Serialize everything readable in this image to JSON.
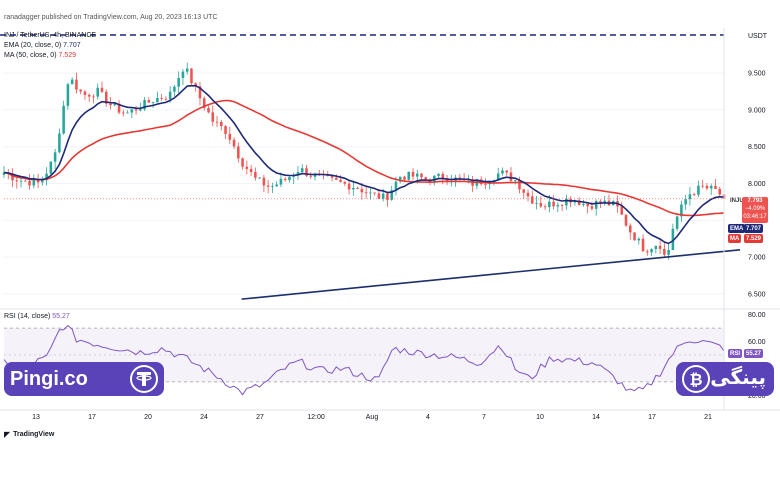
{
  "header": {
    "published": "ranadagger published on TradingView.com, Aug 20, 2023 16:13 UTC",
    "symbol_line": "INJ / TetherUS, 4h, BINANCE",
    "ema_legend": "EMA (20, close, 0)",
    "ema_value": "7.707",
    "ma_legend": "MA (50, close, 0)",
    "ma_value": "7.529",
    "rsi_legend": "RSI (14, close)",
    "rsi_value": "55.27",
    "currency": "USDT"
  },
  "badges": {
    "symbol": "INJUSDT",
    "price": "7.793",
    "change": "−4.09%",
    "countdown": "03:46:17",
    "ema_tag": "EMA",
    "ema_val": "7.707",
    "ma_tag": "MA",
    "ma_val": "7.529",
    "rsi_tag": "RSI",
    "rsi_val": "55.27"
  },
  "footer": {
    "tradingview": "TradingView",
    "logo_left": "Pingi.co",
    "logo_right": "پینگی"
  },
  "colors": {
    "up": "#26a69a",
    "down": "#ef5350",
    "ema": "#1e2a78",
    "ma": "#e53935",
    "rsi": "#7e57c2",
    "trendline": "#1a2f6b",
    "brand": "#5a43b8"
  },
  "chart_data": {
    "type": "candlestick",
    "price_axis_ticks": [
      "9.500",
      "9.000",
      "8.500",
      "8.000",
      "7.500",
      "7.000",
      "6.500"
    ],
    "rsi_axis_ticks": [
      "80.00",
      "60.00",
      "40.00",
      "20.00"
    ],
    "rsi_bands": [
      30,
      70
    ],
    "x_ticks": [
      "13",
      "17",
      "20",
      "24",
      "27",
      "12:00",
      "Aug",
      "4",
      "7",
      "10",
      "14",
      "17",
      "21"
    ],
    "price_ylim": [
      6.35,
      9.95
    ],
    "rsi_ylim": [
      15,
      82
    ],
    "last_price": 7.793,
    "ema_last": 7.707,
    "ma_last": 7.529,
    "rsi_last": 55.27,
    "trendline_endpoints": [
      {
        "t": 0.33,
        "price": 6.43
      },
      {
        "t": 1.0,
        "price": 7.1
      }
    ],
    "close_keypoints": [
      [
        0.0,
        8.15
      ],
      [
        0.02,
        8.05
      ],
      [
        0.05,
        8.0
      ],
      [
        0.07,
        8.35
      ],
      [
        0.09,
        9.45
      ],
      [
        0.11,
        9.2
      ],
      [
        0.13,
        9.25
      ],
      [
        0.15,
        9.05
      ],
      [
        0.17,
        8.95
      ],
      [
        0.19,
        9.05
      ],
      [
        0.21,
        9.15
      ],
      [
        0.23,
        9.2
      ],
      [
        0.25,
        9.6
      ],
      [
        0.27,
        9.2
      ],
      [
        0.29,
        8.85
      ],
      [
        0.31,
        8.7
      ],
      [
        0.33,
        8.3
      ],
      [
        0.35,
        8.05
      ],
      [
        0.37,
        7.95
      ],
      [
        0.39,
        8.05
      ],
      [
        0.41,
        8.2
      ],
      [
        0.43,
        8.1
      ],
      [
        0.45,
        8.05
      ],
      [
        0.47,
        8.0
      ],
      [
        0.49,
        7.95
      ],
      [
        0.51,
        7.85
      ],
      [
        0.53,
        7.8
      ],
      [
        0.55,
        8.1
      ],
      [
        0.57,
        8.1
      ],
      [
        0.59,
        8.05
      ],
      [
        0.61,
        8.1
      ],
      [
        0.63,
        8.05
      ],
      [
        0.65,
        8.0
      ],
      [
        0.67,
        8.05
      ],
      [
        0.69,
        8.15
      ],
      [
        0.71,
        8.05
      ],
      [
        0.73,
        7.8
      ],
      [
        0.75,
        7.7
      ],
      [
        0.77,
        7.75
      ],
      [
        0.79,
        7.8
      ],
      [
        0.81,
        7.7
      ],
      [
        0.83,
        7.75
      ],
      [
        0.85,
        7.7
      ],
      [
        0.87,
        7.35
      ],
      [
        0.89,
        7.1
      ],
      [
        0.91,
        7.2
      ],
      [
        0.92,
        6.95
      ],
      [
        0.93,
        7.45
      ],
      [
        0.95,
        7.85
      ],
      [
        0.97,
        7.95
      ],
      [
        0.99,
        7.9
      ],
      [
        1.0,
        7.793
      ]
    ],
    "rsi_keypoints": [
      [
        0.0,
        45
      ],
      [
        0.03,
        42
      ],
      [
        0.06,
        48
      ],
      [
        0.08,
        72
      ],
      [
        0.09,
        70
      ],
      [
        0.1,
        62
      ],
      [
        0.13,
        58
      ],
      [
        0.16,
        55
      ],
      [
        0.19,
        52
      ],
      [
        0.22,
        55
      ],
      [
        0.25,
        48
      ],
      [
        0.27,
        42
      ],
      [
        0.3,
        33
      ],
      [
        0.33,
        22
      ],
      [
        0.36,
        28
      ],
      [
        0.39,
        40
      ],
      [
        0.41,
        45
      ],
      [
        0.44,
        38
      ],
      [
        0.47,
        40
      ],
      [
        0.49,
        36
      ],
      [
        0.52,
        31
      ],
      [
        0.54,
        55
      ],
      [
        0.57,
        52
      ],
      [
        0.6,
        50
      ],
      [
        0.63,
        48
      ],
      [
        0.66,
        44
      ],
      [
        0.69,
        58
      ],
      [
        0.71,
        40
      ],
      [
        0.73,
        32
      ],
      [
        0.76,
        48
      ],
      [
        0.79,
        46
      ],
      [
        0.82,
        44
      ],
      [
        0.85,
        32
      ],
      [
        0.87,
        22
      ],
      [
        0.89,
        24
      ],
      [
        0.91,
        36
      ],
      [
        0.93,
        52
      ],
      [
        0.95,
        62
      ],
      [
        0.97,
        60
      ],
      [
        1.0,
        55.27
      ]
    ]
  }
}
